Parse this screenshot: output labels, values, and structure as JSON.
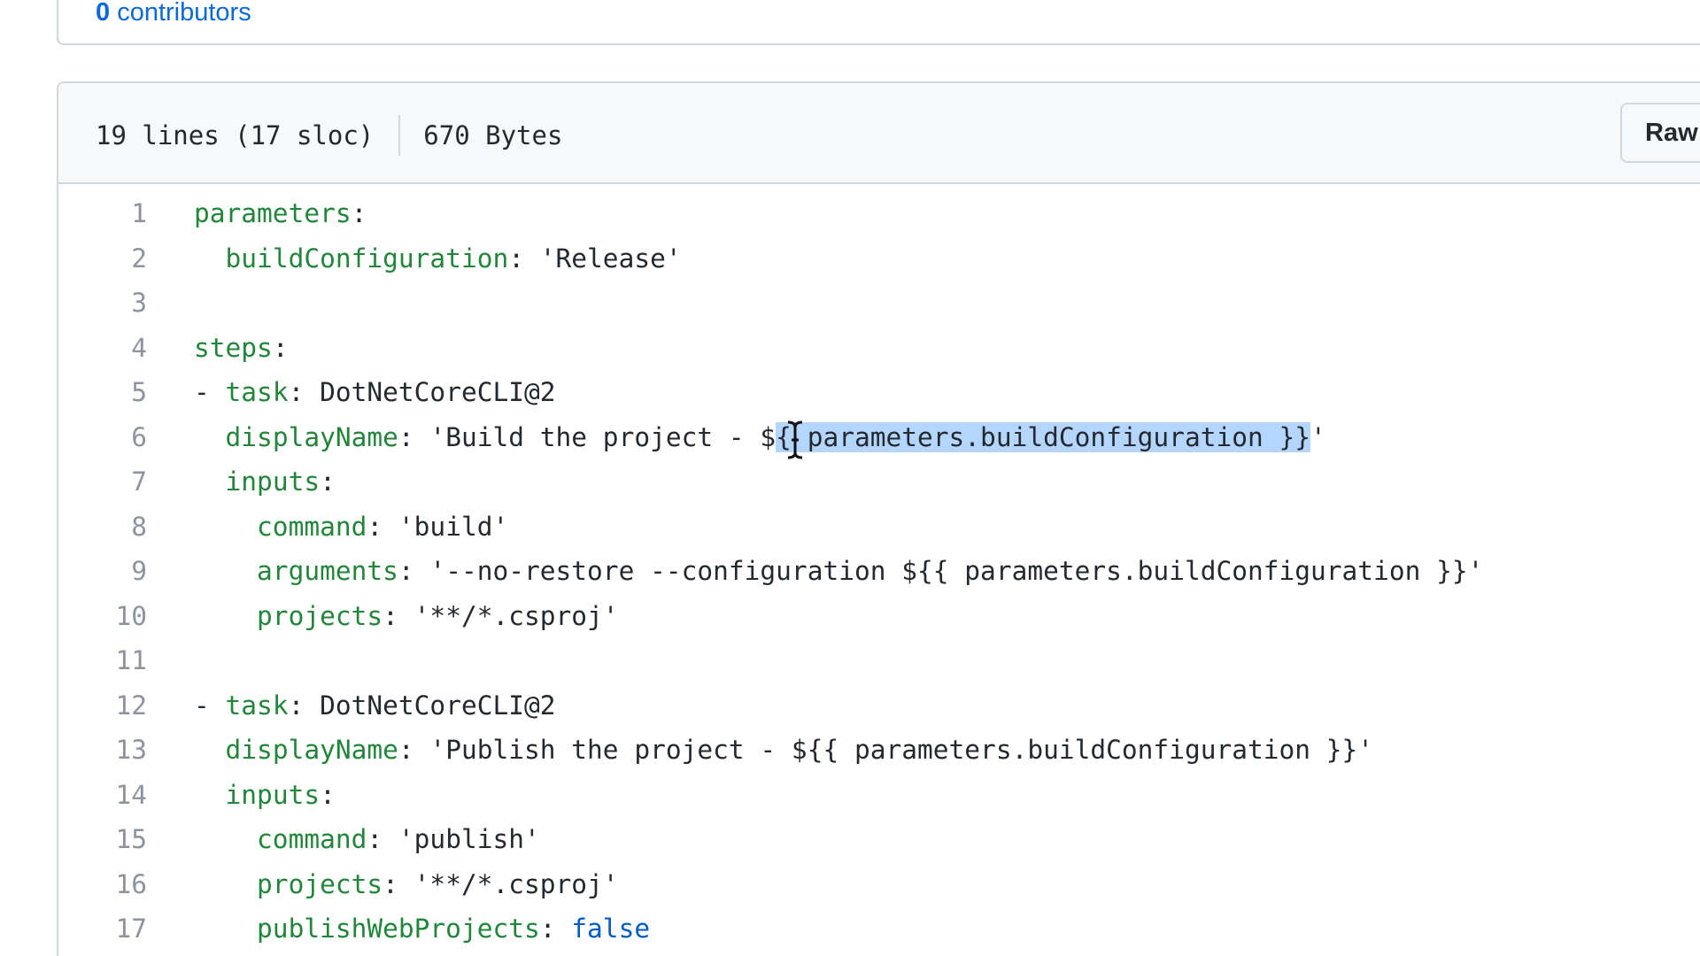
{
  "contributors": {
    "count": "0",
    "label": "contributors"
  },
  "file": {
    "lines_info": "19 lines (17 sloc)",
    "size_info": "670 Bytes",
    "raw_button": "Raw"
  },
  "code": [
    {
      "n": "1",
      "indent": "",
      "key": "parameters",
      "sep": ":",
      "val": ""
    },
    {
      "n": "2",
      "indent": "  ",
      "key": "buildConfiguration",
      "sep": ": ",
      "val": "'Release'"
    },
    {
      "n": "3",
      "indent": "",
      "key": "",
      "sep": "",
      "val": ""
    },
    {
      "n": "4",
      "indent": "",
      "key": "steps",
      "sep": ":",
      "val": ""
    },
    {
      "n": "5",
      "indent": "- ",
      "key": "task",
      "sep": ": ",
      "val": "DotNetCoreCLI@2"
    },
    {
      "n": "6",
      "indent": "  ",
      "key": "displayName",
      "sep": ": ",
      "val_pre": "'Build the project - $",
      "val_sel": "{ parameters.buildConfiguration }}",
      "val_post": "'"
    },
    {
      "n": "7",
      "indent": "  ",
      "key": "inputs",
      "sep": ":",
      "val": ""
    },
    {
      "n": "8",
      "indent": "    ",
      "key": "command",
      "sep": ": ",
      "val": "'build'"
    },
    {
      "n": "9",
      "indent": "    ",
      "key": "arguments",
      "sep": ": ",
      "val": "'--no-restore --configuration ${{ parameters.buildConfiguration }}'"
    },
    {
      "n": "10",
      "indent": "    ",
      "key": "projects",
      "sep": ": ",
      "val": "'**/*.csproj'"
    },
    {
      "n": "11",
      "indent": "",
      "key": "",
      "sep": "",
      "val": ""
    },
    {
      "n": "12",
      "indent": "- ",
      "key": "task",
      "sep": ": ",
      "val": "DotNetCoreCLI@2"
    },
    {
      "n": "13",
      "indent": "  ",
      "key": "displayName",
      "sep": ": ",
      "val": "'Publish the project - ${{ parameters.buildConfiguration }}'"
    },
    {
      "n": "14",
      "indent": "  ",
      "key": "inputs",
      "sep": ":",
      "val": ""
    },
    {
      "n": "15",
      "indent": "    ",
      "key": "command",
      "sep": ": ",
      "val": "'publish'"
    },
    {
      "n": "16",
      "indent": "    ",
      "key": "projects",
      "sep": ": ",
      "val": "'**/*.csproj'"
    },
    {
      "n": "17",
      "indent": "    ",
      "key": "publishWebProjects",
      "sep": ": ",
      "val": "false",
      "val_type": "boolean"
    }
  ],
  "colors": {
    "key": "#22863a",
    "boolean": "#005cc5",
    "selection": "#b4d5fe",
    "link": "#0969da"
  }
}
